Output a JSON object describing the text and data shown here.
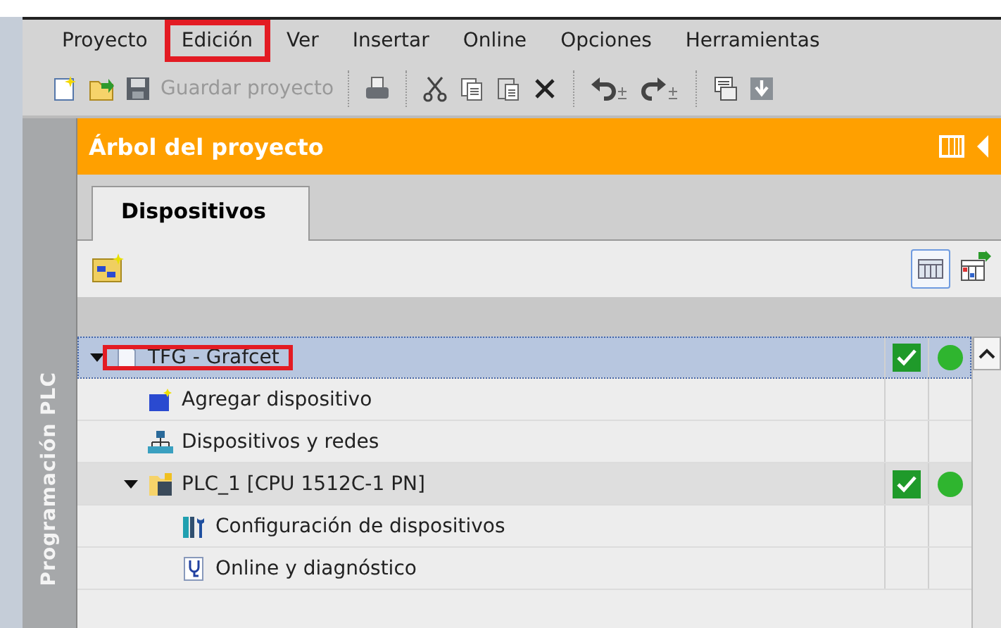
{
  "menu": [
    {
      "label": "Proyecto",
      "highlighted": false
    },
    {
      "label": "Edición",
      "highlighted": true
    },
    {
      "label": "Ver",
      "highlighted": false
    },
    {
      "label": "Insertar",
      "highlighted": false
    },
    {
      "label": "Online",
      "highlighted": false
    },
    {
      "label": "Opciones",
      "highlighted": false
    },
    {
      "label": "Herramientas",
      "highlighted": false
    }
  ],
  "toolbar": [
    {
      "kind": "new"
    },
    {
      "kind": "open"
    },
    {
      "kind": "save",
      "label": "Guardar proyecto",
      "disabled": true
    },
    {
      "kind": "sep"
    },
    {
      "kind": "print"
    },
    {
      "kind": "sep"
    },
    {
      "kind": "cut"
    },
    {
      "kind": "copy"
    },
    {
      "kind": "paste"
    },
    {
      "kind": "delete"
    },
    {
      "kind": "sep"
    },
    {
      "kind": "undo"
    },
    {
      "kind": "redo"
    },
    {
      "kind": "sep"
    },
    {
      "kind": "compile"
    },
    {
      "kind": "download"
    }
  ],
  "side_tab": {
    "label": "Programación PLC"
  },
  "panel": {
    "title": "Árbol del proyecto",
    "tabs": [
      {
        "label": "Dispositivos",
        "selected": true
      }
    ],
    "tree": [
      {
        "label": "TFG - Grafcet",
        "kind": "project",
        "expanded": true,
        "selected": true,
        "highlighted": true,
        "checked": true,
        "online": true,
        "children": [
          {
            "label": "Agregar dispositivo",
            "kind": "add-device",
            "selected": false,
            "highlighted": false,
            "checked": false,
            "online": false
          },
          {
            "label": "Dispositivos y redes",
            "kind": "network",
            "selected": false,
            "highlighted": false,
            "checked": false,
            "online": false
          },
          {
            "label": "PLC_1 [CPU 1512C-1 PN]",
            "kind": "plc",
            "expanded": true,
            "selected": false,
            "highlighted": false,
            "checked": true,
            "online": true,
            "children": [
              {
                "label": "Configuración de dispositivos",
                "kind": "config",
                "selected": false,
                "highlighted": false,
                "checked": false,
                "online": false
              },
              {
                "label": "Online y diagnóstico",
                "kind": "diag",
                "selected": false,
                "highlighted": false,
                "checked": false,
                "online": false
              }
            ]
          }
        ]
      }
    ]
  }
}
